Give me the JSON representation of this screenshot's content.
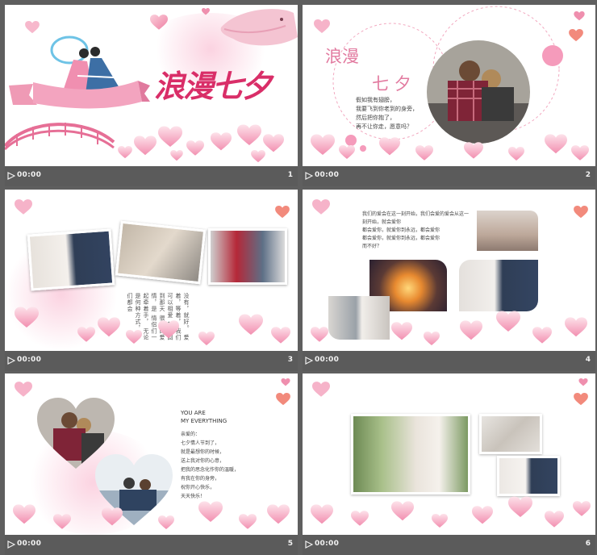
{
  "slides": [
    {
      "number": "1",
      "time": "00:00",
      "title": "浪漫七夕"
    },
    {
      "number": "2",
      "time": "00:00",
      "heading_top": "浪漫",
      "heading_bottom": "七 夕",
      "lines": [
        "假如我有翅膀，",
        "我要飞到你老到的身旁，",
        "然后把你抱了，",
        "再不让你走，愿意吗？"
      ]
    },
    {
      "number": "3",
      "time": "00:00",
      "columns": [
        "无论是何种方式，人们都会",
        "情侣们一起牵着手，",
        "很好的爱情，是",
        "就会回到那天",
        "我们可以相爱",
        "爱着，等着，",
        "没有，就好。"
      ]
    },
    {
      "number": "4",
      "time": "00:00",
      "lines": [
        "我们的爱会在这一刻开始，我们会爱的爱会从这一刻开始，就会爱你",
        "都会爱你，就爱你到永远，都会爱你",
        "都会爱你，就爱你到永远，都会爱你",
        "而不好？"
      ]
    },
    {
      "number": "5",
      "time": "00:00",
      "title_line1": "YOU ARE",
      "title_line2": "MY EVERYTHING",
      "lines": [
        "亲爱的：",
        "七夕情人节到了，",
        "就是最想你的时候，",
        "送上我对你的心意，",
        "把我的思念化作你的温暖，",
        "有我在你的身旁，",
        "祝你开心快乐，",
        "天天快乐！"
      ]
    },
    {
      "number": "6",
      "time": "00:00"
    }
  ],
  "colors": {
    "accent": "#e14b7c",
    "pink_light": "#f6b3c9",
    "bar": "#5b5b5b",
    "background": "#5f5f5f"
  },
  "icons": [
    "play-icon",
    "heart-icon"
  ]
}
